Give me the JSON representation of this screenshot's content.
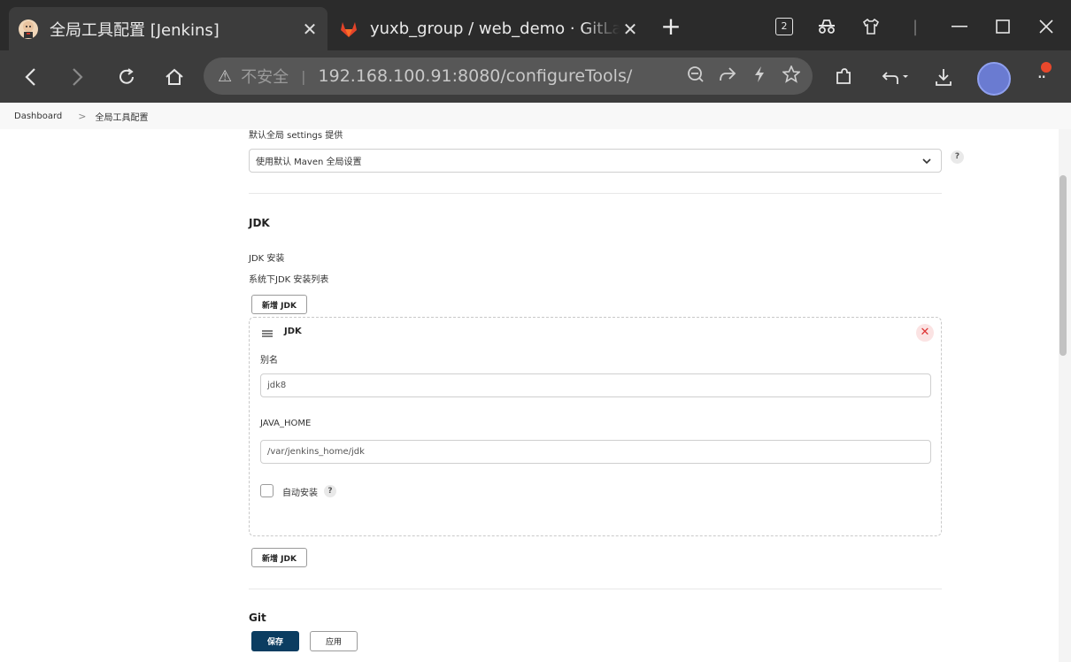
{
  "browser": {
    "tabs": [
      {
        "title": "全局工具配置 [Jenkins]",
        "active": true,
        "icon": "jenkins-icon"
      },
      {
        "title": "yuxb_group / web_demo · GitLab",
        "active": false,
        "icon": "gitlab-icon"
      }
    ],
    "tab_count_badge": "2",
    "address": {
      "security_label": "不安全",
      "url": "192.168.100.91:8080/configureTools/"
    }
  },
  "breadcrumb": {
    "items": [
      "Dashboard",
      "全局工具配置"
    ]
  },
  "maven": {
    "global_settings_label": "默认全局 settings 提供",
    "global_settings_value": "使用默认 Maven 全局设置"
  },
  "jdk": {
    "section_title": "JDK",
    "installations_label": "JDK 安装",
    "installations_desc": "系统下JDK 安装列表",
    "add_button": "新增 JDK",
    "entry": {
      "header": "JDK",
      "name_label": "别名",
      "name_value": "jdk8",
      "home_label": "JAVA_HOME",
      "home_value": "/var/jenkins_home/jdk",
      "auto_install_label": "自动安装",
      "auto_install_checked": false
    }
  },
  "git": {
    "section_title": "Git"
  },
  "actions": {
    "save": "保存",
    "apply": "应用"
  },
  "colors": {
    "primary_button": "#0b3d61",
    "delete_accent": "#dd3333",
    "gitlab_orange": "#e24329"
  }
}
